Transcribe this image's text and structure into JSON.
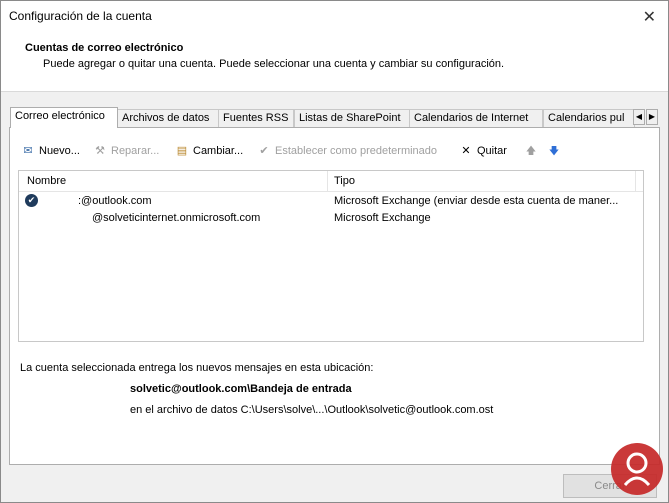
{
  "window": {
    "title": "Configuración de la cuenta",
    "close_glyph": "✕"
  },
  "header": {
    "title": "Cuentas de correo electrónico",
    "subtitle": "Puede agregar o quitar una cuenta. Puede seleccionar una cuenta y cambiar su configuración."
  },
  "tabs": [
    {
      "label": "Correo electrónico",
      "active": true
    },
    {
      "label": "Archivos de datos",
      "active": false
    },
    {
      "label": "Fuentes RSS",
      "active": false
    },
    {
      "label": "Listas de SharePoint",
      "active": false
    },
    {
      "label": "Calendarios de Internet",
      "active": false
    },
    {
      "label": "Calendarios pul",
      "active": false
    }
  ],
  "tab_scroll": {
    "left": "◀",
    "right": "▶"
  },
  "toolbar": {
    "new": {
      "label": "Nuevo...",
      "icon": "new-mail-icon",
      "glyph": "✉"
    },
    "repair": {
      "label": "Reparar...",
      "icon": "wrench-icon",
      "glyph": "⚒",
      "disabled": true
    },
    "change": {
      "label": "Cambiar...",
      "icon": "change-account-icon",
      "glyph": "▤"
    },
    "set_default": {
      "label": "Establecer como predeterminado",
      "icon": "check-circle-icon",
      "glyph": "✔",
      "disabled": true
    },
    "remove": {
      "label": "Quitar",
      "icon": "x-icon",
      "glyph": "✕"
    },
    "up": {
      "icon": "arrow-up-icon",
      "glyph": "🡅",
      "disabled": true
    },
    "down": {
      "icon": "arrow-down-icon",
      "glyph": "🡇"
    }
  },
  "list": {
    "columns": [
      "Nombre",
      "Tipo"
    ],
    "rows": [
      {
        "name": ":@outlook.com",
        "type": "Microsoft Exchange (enviar desde esta cuenta de maner...",
        "default": true
      },
      {
        "name": "@solveticinternet.onmicrosoft.com",
        "type": "Microsoft Exchange",
        "default": false
      }
    ]
  },
  "info": {
    "description": "La cuenta seleccionada entrega los nuevos mensajes en esta ubicación:",
    "location": "solvetic@outlook.com\\Bandeja de entrada",
    "data_file": "en el archivo de datos C:\\Users\\solve\\...\\Outlook\\solvetic@outlook.com.ost"
  },
  "footer": {
    "close_label": "Cerrar"
  },
  "colors": {
    "accent": "#1f3b5c",
    "disabled": "#a0a0a0",
    "watermark": "#c62828"
  }
}
